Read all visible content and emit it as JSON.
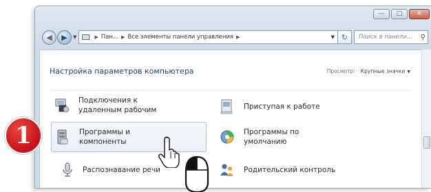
{
  "window": {
    "address": {
      "seg1": "Пан...",
      "seg2": "Все элементы панели управления"
    },
    "search_placeholder": "Поиск в панели...",
    "caption_buttons": [
      "minimize",
      "maximize",
      "close"
    ]
  },
  "content": {
    "title": "Настройка параметров компьютера",
    "view_label": "Просмотр:",
    "view_value": "Крупные значки",
    "items": [
      {
        "label": "Подключения к\nудаленным рабочим",
        "icon": "remote-desktop-icon"
      },
      {
        "label": "Приступая к работе",
        "icon": "getting-started-icon"
      },
      {
        "label": "Программы и\nкомпоненты",
        "icon": "programs-features-icon"
      },
      {
        "label": "Программы по\nумолчанию",
        "icon": "default-programs-icon"
      },
      {
        "label": "Распознавание речи",
        "icon": "speech-recognition-icon"
      },
      {
        "label": "Родительский контроль",
        "icon": "parental-controls-icon"
      }
    ]
  },
  "badge": {
    "number": "1"
  },
  "colors": {
    "badge_red": "#c4121a",
    "link_blue": "#1e3d5c",
    "frame": "#cfdbe7"
  }
}
